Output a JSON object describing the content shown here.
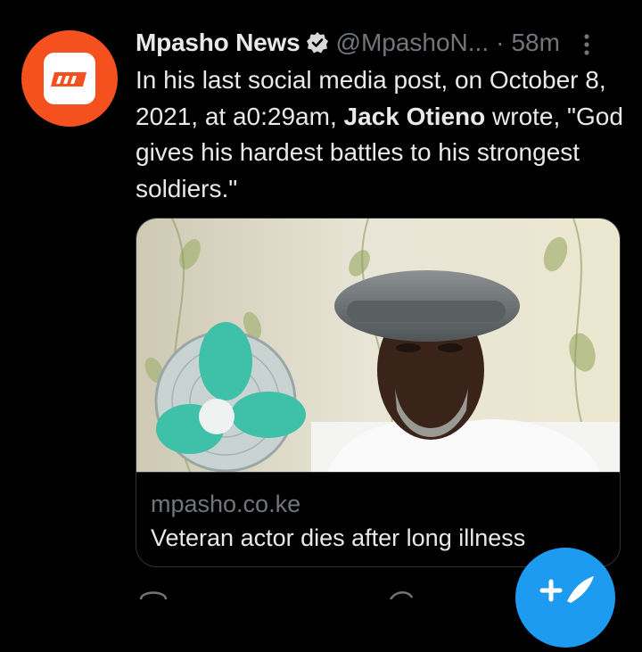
{
  "tweet": {
    "author_name": "Mpasho News",
    "author_handle": "@MpashoN...",
    "separator": "·",
    "timestamp": "58m",
    "text_part1": "In his last social media post, on October 8, 2021, at a0:29am, ",
    "text_bold": "Jack Otieno",
    "text_part2": " wrote, \"God gives his hardest battles to his strongest soldiers.\"",
    "avatar_color": "#f4511e"
  },
  "card": {
    "domain": "mpasho.co.ke",
    "title": "Veteran actor dies after long illness"
  },
  "colors": {
    "background": "#000000",
    "text": "#e7e9ea",
    "secondary": "#71767b",
    "accent": "#1d9bf0"
  },
  "icons": [
    "verified-badge-icon",
    "more-options-icon",
    "compose-icon"
  ]
}
